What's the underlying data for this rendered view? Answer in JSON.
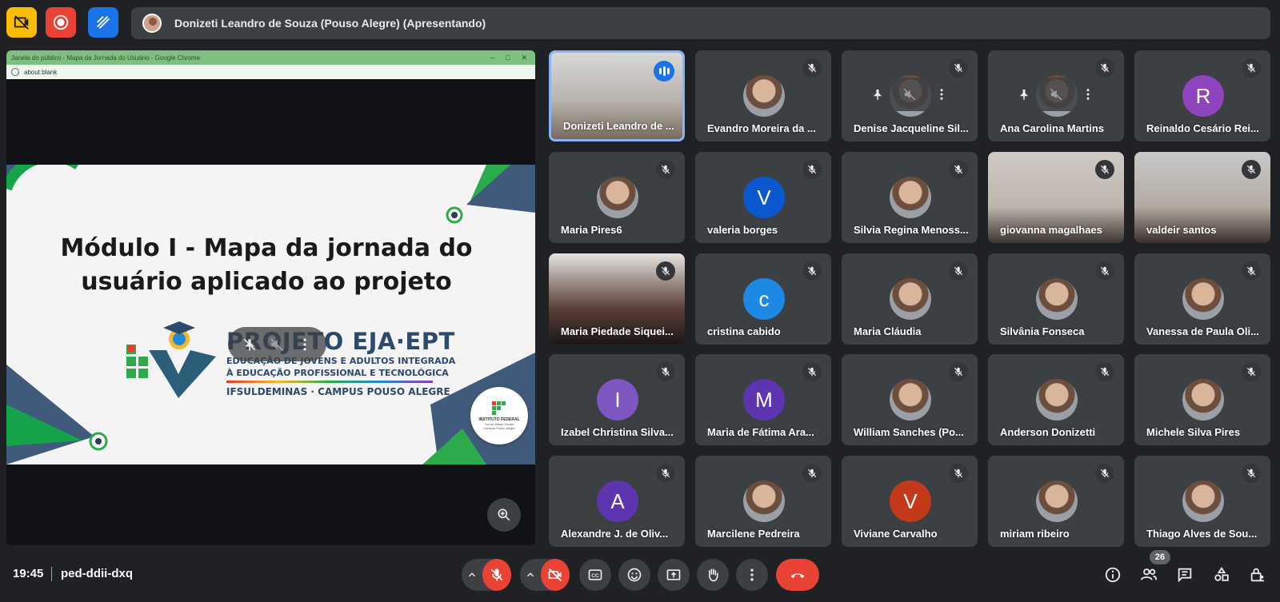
{
  "topbar": {
    "presenter_text": "Donizeti Leandro de Souza (Pouso Alegre) (Apresentando)",
    "icons": [
      "no-camera-share-icon",
      "record-icon",
      "whiteboard-icon"
    ]
  },
  "shared_window": {
    "title": "Janela do público - Mapa da Jornada do Usuário - Google Chrome",
    "address": "about:blank",
    "slide": {
      "title": "Módulo I - Mapa da jornada do usuário aplicado ao projeto",
      "project_name": "PROJETO EJA·EPT",
      "subtitle_line1": "EDUCAÇÃO DE JOVENS E ADULTOS INTEGRADA",
      "subtitle_line2": "À EDUCAÇÃO PROFISSIONAL E TECNOLÓGICA",
      "campus": "IFSULDEMINAS · CAMPUS POUSO ALEGRE",
      "badge_title": "INSTITUTO FEDERAL",
      "badge_sub": "Sul de Minas Gerais",
      "badge_campus": "Campus Pouso Alegre"
    }
  },
  "participants": [
    {
      "name": "Donizeti Leandro de ...",
      "type": "video",
      "speaking": true
    },
    {
      "name": "Evandro Moreira da ...",
      "type": "photo"
    },
    {
      "name": "Denise Jacqueline Sil...",
      "type": "photo",
      "pinbar": true
    },
    {
      "name": "Ana Carolina Martins",
      "type": "photo",
      "pinbar": true
    },
    {
      "name": "Reinaldo Cesário Rei...",
      "type": "letter",
      "letter": "R",
      "color": "#8e44bd"
    },
    {
      "name": "Maria Pires6",
      "type": "photo"
    },
    {
      "name": "valeria borges",
      "type": "letter",
      "letter": "V",
      "color": "#0b57d0"
    },
    {
      "name": "Silvia Regina Menoss...",
      "type": "photo"
    },
    {
      "name": "giovanna magalhaes",
      "type": "video"
    },
    {
      "name": "valdeir santos",
      "type": "video"
    },
    {
      "name": "Maria Piedade Siquei...",
      "type": "video"
    },
    {
      "name": "cristina cabido",
      "type": "letter",
      "letter": "c",
      "color": "#1e88e5"
    },
    {
      "name": "Maria Cláudia",
      "type": "photo"
    },
    {
      "name": "Silvânia Fonseca",
      "type": "photo"
    },
    {
      "name": "Vanessa de Paula Oli...",
      "type": "photo"
    },
    {
      "name": "Izabel Christina Silva...",
      "type": "letter",
      "letter": "I",
      "color": "#7e57c2"
    },
    {
      "name": "Maria de Fátima Ara...",
      "type": "letter",
      "letter": "M",
      "color": "#5e35b1"
    },
    {
      "name": "William Sanches (Po...",
      "type": "photo"
    },
    {
      "name": "Anderson Donizetti",
      "type": "photo"
    },
    {
      "name": "Michele Silva Pires",
      "type": "photo"
    },
    {
      "name": "Alexandre J. de Oliv...",
      "type": "letter",
      "letter": "A",
      "color": "#5e35b1"
    },
    {
      "name": "Marcilene Pedreira",
      "type": "photo"
    },
    {
      "name": "Viviane Carvalho",
      "type": "letter",
      "letter": "V",
      "color": "#c5391b"
    },
    {
      "name": "miriam ribeiro",
      "type": "photo"
    },
    {
      "name": "Thiago Alves de Sou...",
      "type": "photo"
    }
  ],
  "bottombar": {
    "time": "19:45",
    "meeting_code": "ped-ddii-dxq",
    "participant_count": "26"
  },
  "colors": {
    "background": "#202124",
    "tile": "#3c4043",
    "danger": "#ea4335",
    "accent": "#8ab4f8"
  }
}
